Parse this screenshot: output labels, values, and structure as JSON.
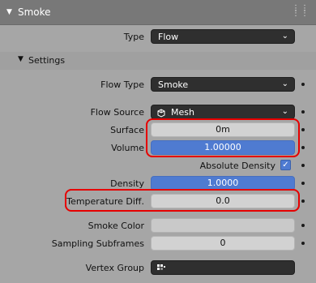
{
  "panel": {
    "title": "Smoke"
  },
  "type_row": {
    "label": "Type",
    "value": "Flow"
  },
  "settings": {
    "title": "Settings"
  },
  "flow_type": {
    "label": "Flow Type",
    "value": "Smoke"
  },
  "flow_source": {
    "label": "Flow Source",
    "value": "Mesh",
    "icon": "mesh-icon"
  },
  "surface": {
    "label": "Surface",
    "value": "0m"
  },
  "volume": {
    "label": "Volume",
    "value": "1.00000"
  },
  "absolute_density": {
    "label": "Absolute Density",
    "checked": true
  },
  "density": {
    "label": "Density",
    "value": "1.0000"
  },
  "temperature_diff": {
    "label": "Temperature Diff.",
    "value": "0.0"
  },
  "smoke_color": {
    "label": "Smoke Color",
    "color": "#c9c9c9"
  },
  "sampling_subframes": {
    "label": "Sampling Subframes",
    "value": "0"
  },
  "vertex_group": {
    "label": "Vertex Group",
    "value": "",
    "icon": "vertex-group-icon"
  },
  "colors": {
    "accent": "#4f7bd1",
    "highlight": "#e60000",
    "header": "#787878"
  }
}
